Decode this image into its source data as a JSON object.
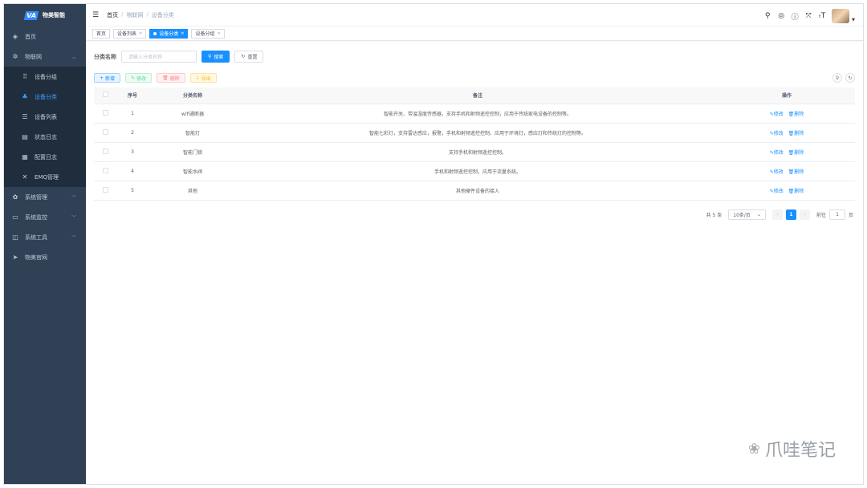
{
  "app": {
    "logo_text": "物美智能",
    "logo_mark": "VA"
  },
  "sidebar": {
    "items": [
      {
        "icon": "dashboard-icon",
        "label": "首页"
      },
      {
        "icon": "iot-icon",
        "label": "物联网",
        "expanded": true,
        "children": [
          {
            "icon": "grid-icon",
            "label": "设备分组"
          },
          {
            "icon": "category-icon",
            "label": "设备分类",
            "active": true
          },
          {
            "icon": "list-icon",
            "label": "设备列表"
          },
          {
            "icon": "status-log-icon",
            "label": "状态日志"
          },
          {
            "icon": "config-log-icon",
            "label": "配置日志"
          },
          {
            "icon": "emq-icon",
            "label": "EMQ管理"
          }
        ]
      },
      {
        "icon": "gear-icon",
        "label": "系统管理"
      },
      {
        "icon": "monitor-icon",
        "label": "系统监控"
      },
      {
        "icon": "tools-icon",
        "label": "系统工具"
      },
      {
        "icon": "send-icon",
        "label": "物美官网"
      }
    ]
  },
  "navbar": {
    "breadcrumb": [
      "首页",
      "物联网",
      "设备分类"
    ]
  },
  "tags": [
    {
      "label": "首页"
    },
    {
      "label": "设备列表"
    },
    {
      "label": "设备分类",
      "active": true
    },
    {
      "label": "设备分组"
    }
  ],
  "search": {
    "label": "分类名称",
    "placeholder": "请输入分类名称",
    "search_btn": "搜索",
    "reset_btn": "重置"
  },
  "actions": {
    "add": "新增",
    "edit": "修改",
    "delete": "删除",
    "export": "导出"
  },
  "table": {
    "headers": [
      "序号",
      "分类名称",
      "备注",
      "操作"
    ],
    "rows": [
      {
        "no": "1",
        "name": "wifi通断器",
        "remark": "智能开关、带温湿度传感器，支持手机和射频遥控控制，应用于传统家电设备的控制等。"
      },
      {
        "no": "2",
        "name": "智能灯",
        "remark": "智能七彩灯，支持雷达感应，报警，手机和射频遥控控制，应用于环境灯，感应灯和传统灯的控制等。"
      },
      {
        "no": "3",
        "name": "智能门锁",
        "remark": "支持手机和射频遥控控制。"
      },
      {
        "no": "4",
        "name": "智能水阀",
        "remark": "手机和射频遥控控制，应用于流量系统。"
      },
      {
        "no": "5",
        "name": "其他",
        "remark": "其他硬件设备的接入"
      }
    ],
    "op_edit": "修改",
    "op_delete": "删除"
  },
  "pagination": {
    "total_text": "共 5 条",
    "page_size": "10条/页",
    "current": "1",
    "goto_label": "前往",
    "goto_value": "1",
    "page_unit": "页"
  },
  "watermark": "爪哇笔记",
  "colors": {
    "sidebar_bg": "#304156",
    "primary": "#1890ff"
  }
}
